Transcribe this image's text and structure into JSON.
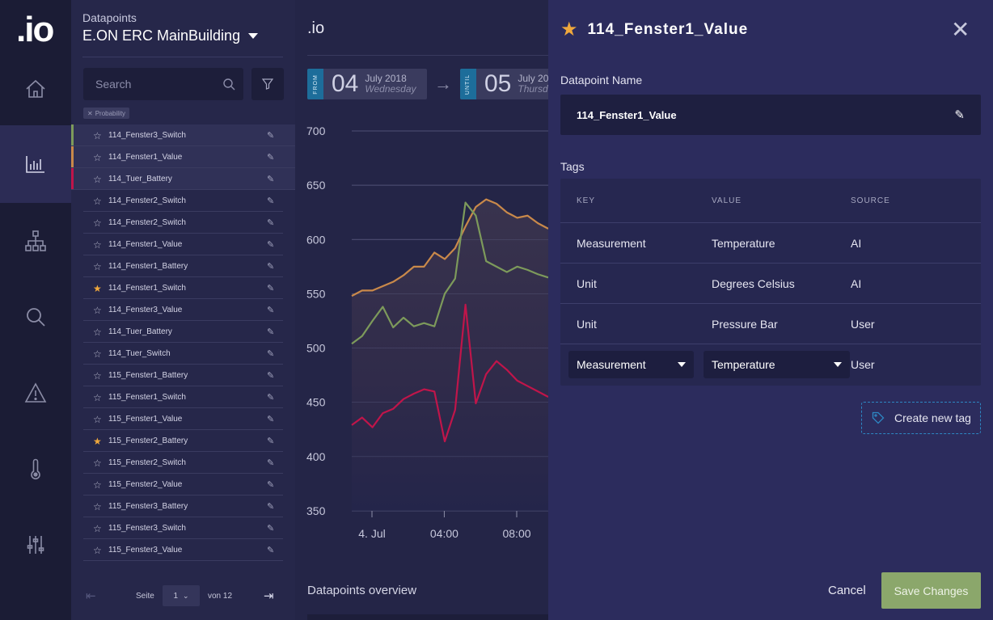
{
  "app": {
    "logo": ".io"
  },
  "rail": {
    "items": [
      {
        "name": "home-icon",
        "active": false
      },
      {
        "name": "chart-icon",
        "active": true
      },
      {
        "name": "hierarchy-icon",
        "active": false
      },
      {
        "name": "search-icon",
        "active": false
      },
      {
        "name": "warning-icon",
        "active": false
      },
      {
        "name": "thermometer-icon",
        "active": false
      },
      {
        "name": "sliders-icon",
        "active": false
      }
    ]
  },
  "datapoints": {
    "caption": "Datapoints",
    "building": "E.ON ERC MainBuilding",
    "search_placeholder": "Search",
    "filter_chip": "Probability",
    "items": [
      {
        "label": "114_Fenster3_Switch",
        "selected": true,
        "accent": "#7d9a5b",
        "favorite": false
      },
      {
        "label": "114_Fenster1_Value",
        "selected": true,
        "accent": "#c9894a",
        "favorite": false
      },
      {
        "label": "114_Tuer_Battery",
        "selected": true,
        "accent": "#c0154a",
        "favorite": false
      },
      {
        "label": "114_Fenster2_Switch",
        "selected": false,
        "favorite": false
      },
      {
        "label": "114_Fenster2_Switch",
        "selected": false,
        "favorite": false
      },
      {
        "label": "114_Fenster1_Value",
        "selected": false,
        "favorite": false
      },
      {
        "label": "114_Fenster1_Battery",
        "selected": false,
        "favorite": false
      },
      {
        "label": "114_Fenster1_Switch",
        "selected": false,
        "favorite": true
      },
      {
        "label": "114_Fenster3_Value",
        "selected": false,
        "favorite": false
      },
      {
        "label": "114_Tuer_Battery",
        "selected": false,
        "favorite": false
      },
      {
        "label": "114_Tuer_Switch",
        "selected": false,
        "favorite": false
      },
      {
        "label": "115_Fenster1_Battery",
        "selected": false,
        "favorite": false
      },
      {
        "label": "115_Fenster1_Switch",
        "selected": false,
        "favorite": false
      },
      {
        "label": "115_Fenster1_Value",
        "selected": false,
        "favorite": false
      },
      {
        "label": "115_Fenster2_Battery",
        "selected": false,
        "favorite": true
      },
      {
        "label": "115_Fenster2_Switch",
        "selected": false,
        "favorite": false
      },
      {
        "label": "115_Fenster2_Value",
        "selected": false,
        "favorite": false
      },
      {
        "label": "115_Fenster3_Battery",
        "selected": false,
        "favorite": false
      },
      {
        "label": "115_Fenster3_Switch",
        "selected": false,
        "favorite": false
      },
      {
        "label": "115_Fenster3_Value",
        "selected": false,
        "favorite": false
      }
    ],
    "pager": {
      "seite": "Seite",
      "page": "1",
      "von": "von 12"
    }
  },
  "main": {
    "title": ".io",
    "from": {
      "tag": "FROM",
      "day": "04",
      "month": "July 2018",
      "weekday": "Wednesday"
    },
    "until": {
      "tag": "UNTIL",
      "day": "05",
      "month": "July 20",
      "weekday": "Thursd"
    },
    "overview_title": "Datapoints overview"
  },
  "chart_data": {
    "type": "line",
    "ylim": [
      350,
      700
    ],
    "yticks": [
      700,
      650,
      600,
      550,
      500,
      450,
      400,
      350
    ],
    "xticks": [
      "4. Jul",
      "04:00",
      "08:00"
    ],
    "x": [
      0,
      0.77,
      1.54,
      2.31,
      3.08,
      3.85,
      4.62,
      5.38,
      6.15,
      6.92,
      7.69,
      8.46,
      9.23,
      10,
      10.77,
      11.54,
      12.31,
      13.08,
      13.85,
      14.62
    ],
    "series": [
      {
        "color": "#c9894a",
        "values": [
          548,
          553,
          553,
          557,
          561,
          567,
          575,
          575,
          588,
          582,
          592,
          612,
          630,
          637,
          633,
          625,
          620,
          622,
          615,
          610
        ]
      },
      {
        "color": "#7d9a5b",
        "values": [
          504,
          511,
          525,
          538,
          519,
          528,
          520,
          523,
          520,
          550,
          564,
          634,
          622,
          580,
          575,
          570,
          575,
          572,
          568,
          565
        ]
      },
      {
        "color": "#c0154a",
        "values": [
          429,
          436,
          427,
          440,
          444,
          453,
          458,
          462,
          460,
          414,
          443,
          540,
          449,
          476,
          488,
          480,
          470,
          465,
          460,
          455
        ]
      }
    ]
  },
  "detail": {
    "title": "114_Fenster1_Value",
    "name_label": "Datapoint Name",
    "name_value": "114_Fenster1_Value",
    "tags_label": "Tags",
    "headers": {
      "key": "KEY",
      "value": "VALUE",
      "source": "SOURCE"
    },
    "rows": [
      {
        "key": "Measurement",
        "value": "Temperature",
        "source": "AI"
      },
      {
        "key": "Unit",
        "value": "Degrees Celsius",
        "source": "AI"
      },
      {
        "key": "Unit",
        "value": "Pressure Bar",
        "source": "User"
      }
    ],
    "edit_row": {
      "key": "Measurement",
      "value": "Temperature",
      "source": "User"
    },
    "new_tag": "Create new tag",
    "cancel": "Cancel",
    "save": "Save Changes",
    "accent_color": "#8ba76b"
  }
}
